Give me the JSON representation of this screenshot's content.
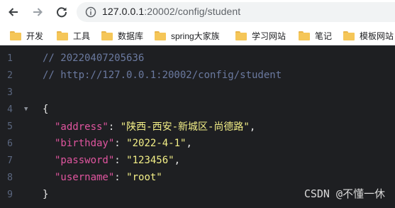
{
  "browser": {
    "url_host": "127.0.0.1",
    "url_rest": ":20002/config/student"
  },
  "bookmarks": [
    {
      "label": "开发"
    },
    {
      "label": "工具"
    },
    {
      "label": "数据库"
    },
    {
      "label": "spring大家族"
    },
    {
      "label": "学习网站"
    },
    {
      "label": "笔记"
    },
    {
      "label": "模板网站"
    }
  ],
  "code": {
    "lines": [
      {
        "num": "1",
        "comment": "// 20220407205636"
      },
      {
        "num": "2",
        "comment": "// http://127.0.0.1:20002/config/student"
      },
      {
        "num": "3"
      },
      {
        "num": "4",
        "open": "{"
      },
      {
        "num": "5",
        "key": "\"address\"",
        "value": "\"陕西-西安-新城区-尚德路\""
      },
      {
        "num": "6",
        "key": "\"birthday\"",
        "value": "\"2022-4-1\""
      },
      {
        "num": "7",
        "key": "\"password\"",
        "value": "\"123456\""
      },
      {
        "num": "8",
        "key": "\"username\"",
        "value": "\"root\""
      },
      {
        "num": "9",
        "close": "}"
      }
    ],
    "colon": ": ",
    "comma": ","
  },
  "watermark": "CSDN @不懂一休",
  "colors": {
    "background": "#1e1f22",
    "comment": "#6b7aa0",
    "key": "#e0559f",
    "string": "#f3ef87",
    "folder": "#f5c658"
  }
}
